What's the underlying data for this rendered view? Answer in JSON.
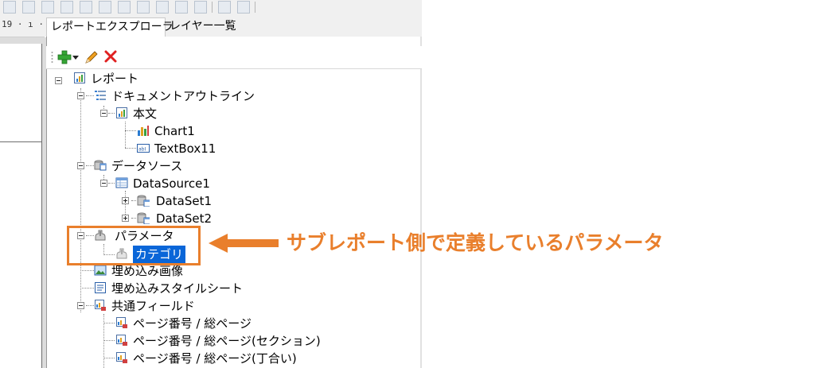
{
  "tabs": [
    {
      "label": "レポートエクスプローラ",
      "active": true
    },
    {
      "label": "レイヤー一覧",
      "active": false
    }
  ],
  "ruler": {
    "text": "19 · ı ·"
  },
  "toolbar": {
    "add_icon": "green-plus-icon",
    "dropdown_icon": "chevron-down-icon",
    "edit_icon": "pencil-icon",
    "delete_icon": "red-x-icon"
  },
  "tree": [
    {
      "label": "レポート",
      "icon": "report-icon"
    },
    {
      "label": "ドキュメントアウトライン",
      "icon": "outline-icon"
    },
    {
      "label": "本文",
      "icon": "body-icon"
    },
    {
      "label": "Chart1",
      "icon": "chart-icon"
    },
    {
      "label": "TextBox11",
      "icon": "textbox-icon"
    },
    {
      "label": "データソース",
      "icon": "datasources-icon"
    },
    {
      "label": "DataSource1",
      "icon": "datasource-icon"
    },
    {
      "label": "DataSet1",
      "icon": "dataset-icon"
    },
    {
      "label": "DataSet2",
      "icon": "dataset-icon"
    },
    {
      "label": "パラメータ",
      "icon": "parameters-icon"
    },
    {
      "label": "カテゴリ",
      "icon": "parameter-icon",
      "selected": true
    },
    {
      "label": "埋め込み画像",
      "icon": "embedded-image-icon"
    },
    {
      "label": "埋め込みスタイルシート",
      "icon": "stylesheet-icon"
    },
    {
      "label": "共通フィールド",
      "icon": "common-fields-icon"
    },
    {
      "label": "ページ番号 / 総ページ",
      "icon": "field-icon"
    },
    {
      "label": "ページ番号 / 総ページ(セクション)",
      "icon": "field-icon"
    },
    {
      "label": "ページ番号 / 総ページ(丁合い)",
      "icon": "field-icon"
    }
  ],
  "callout": {
    "text": "サブレポート側で定義しているパラメータ",
    "color": "#e97f2c"
  },
  "colors": {
    "selection": "#0a66d8",
    "callout": "#e97f2c"
  }
}
